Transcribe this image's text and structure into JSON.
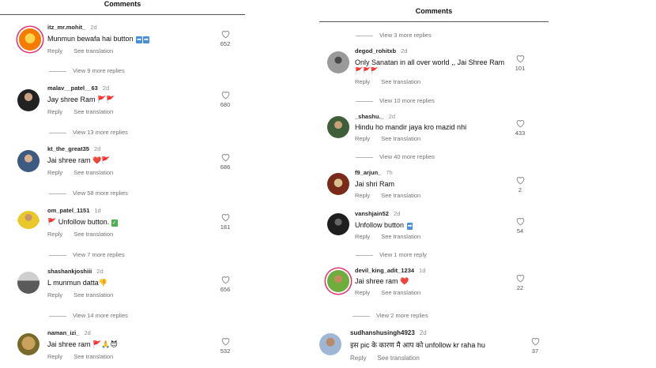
{
  "left": {
    "header": "Comments",
    "comments": [
      {
        "user": "itz_mr.mohit_",
        "time": "2d",
        "text": "Munmun bewafa hai button",
        "emoji": "➡️➡️",
        "likes": "652",
        "reply": "Reply",
        "translate": "See translation"
      },
      {
        "user": "malav__patel__63",
        "time": "2d",
        "text": "Jay shree Ram",
        "emoji": "🚩🚩",
        "likes": "680",
        "reply": "Reply",
        "translate": "See translation"
      },
      {
        "user": "kt_the_great35",
        "time": "2d",
        "text": "Jai shree ram",
        "emoji": "❤️🚩",
        "likes": "686",
        "reply": "Reply",
        "translate": "See translation"
      },
      {
        "user": "om_patel_1151",
        "time": "1d",
        "text": "Unfollow button.",
        "emoji_pre": "🚩",
        "emoji": "✅",
        "likes": "181",
        "reply": "Reply",
        "translate": "See translation"
      },
      {
        "user": "shashankjoshiii",
        "time": "2d",
        "text": "L munmun datta",
        "emoji": "👎",
        "likes": "656",
        "reply": "Reply",
        "translate": "See translation"
      },
      {
        "user": "naman_izi_",
        "time": "2d",
        "text": "Jai shree ram",
        "emoji": "🚩🙏😈",
        "likes": "532",
        "reply": "Reply",
        "translate": "See translation"
      }
    ],
    "more": [
      "View 9 more replies",
      "View 13 more replies",
      "View 58 more replies",
      "View 7 more replies",
      "View 14 more replies"
    ]
  },
  "right": {
    "header": "Comments",
    "top_more": "View 3 more replies",
    "comments": [
      {
        "user": "degod_rohitxb",
        "time": "2d",
        "text": "Only Sanatan in all over world ,, Jai Shree Ram",
        "emoji": "🚩🚩🚩",
        "likes": "101",
        "reply": "Reply",
        "translate": "See translation"
      },
      {
        "user": "_shashu._",
        "time": "2d",
        "text": "Hindu ho mandir jaya kro mazid nhi",
        "emoji": "",
        "likes": "433",
        "reply": "Reply",
        "translate": "See translation"
      },
      {
        "user": "f9_arjun_",
        "time": "7h",
        "text": "Jai shri Ram",
        "emoji": "",
        "likes": "2",
        "reply": "Reply",
        "translate": "See translation"
      },
      {
        "user": "vanshjain52",
        "time": "2d",
        "text": "Unfollow button",
        "emoji": "➡️",
        "likes": "54",
        "reply": "Reply",
        "translate": "See translation"
      },
      {
        "user": "devil_king_adit_1234",
        "time": "1d",
        "text": "Jai shree ram",
        "emoji": "❤️",
        "likes": "22",
        "reply": "Reply",
        "translate": "See translation"
      },
      {
        "user": "sudhanshusingh4923",
        "time": "2d",
        "text": "इस pic के कारण मै आप को unfollow kr raha hu",
        "emoji": "",
        "likes": "37",
        "reply": "Reply",
        "translate": "See translation"
      }
    ],
    "more": [
      "View 10 more replies",
      "View 40 more replies",
      "View 1 more reply",
      "View 2 more replies"
    ]
  },
  "icons": {
    "heart": "heart-outline-icon",
    "avatar": "profile-avatar"
  }
}
